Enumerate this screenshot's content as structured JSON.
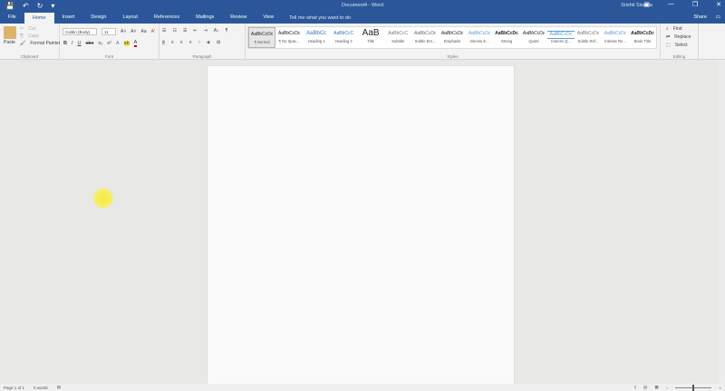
{
  "titlebar": {
    "title": "Document4 - Word",
    "user": "Srishti Sisodia",
    "qat": {
      "save": "💾",
      "undo": "↶",
      "redo": "↻",
      "customize": "▾"
    },
    "min": "—",
    "max": "❐",
    "close": "✕",
    "display": "▣"
  },
  "tabs": [
    "File",
    "Home",
    "Insert",
    "Design",
    "Layout",
    "References",
    "Mailings",
    "Review",
    "View"
  ],
  "tell_me": "Tell me what you want to do",
  "share": "Share",
  "clipboard": {
    "paste": "Paste",
    "cut": "Cut",
    "copy": "Copy",
    "format_painter": "Format Painter",
    "label": "Clipboard"
  },
  "font": {
    "name": "Calibri (Body)",
    "size": "11",
    "grow": "A˄",
    "shrink": "A˅",
    "case": "Aa",
    "clear": "A̸",
    "bold": "B",
    "italic": "I",
    "underline": "U",
    "strike": "abc",
    "sub": "x₂",
    "sup": "x²",
    "effects": "A",
    "highlight": "ab",
    "color": "A",
    "label": "Font"
  },
  "paragraph": {
    "label": "Paragraph",
    "bullets": "☰",
    "numbering": "☷",
    "multilevel": "☰",
    "dec_indent": "⇤",
    "inc_indent": "⇥",
    "sort": "A↓",
    "pilcrow": "¶",
    "left": "≡",
    "center": "≡",
    "right": "≡",
    "justify": "≡",
    "spacing": "↕",
    "shading": "◈",
    "borders": "⊞"
  },
  "styles": {
    "label": "Styles",
    "items": [
      {
        "preview": "AaBbCcDc",
        "name": "¶ Normal"
      },
      {
        "preview": "AaBbCcDc",
        "name": "¶ No Spac..."
      },
      {
        "preview": "AaBbCc",
        "name": "Heading 1"
      },
      {
        "preview": "AaBbCcC",
        "name": "Heading 2"
      },
      {
        "preview": "AaB",
        "name": "Title"
      },
      {
        "preview": "AaBbCcC",
        "name": "Subtitle"
      },
      {
        "preview": "AaBbCcDc",
        "name": "Subtle Em..."
      },
      {
        "preview": "AaBbCcDc",
        "name": "Emphasis"
      },
      {
        "preview": "AaBbCcDc",
        "name": "Intense E..."
      },
      {
        "preview": "AaBbCcDc",
        "name": "Strong"
      },
      {
        "preview": "AaBbCcDc",
        "name": "Quote"
      },
      {
        "preview": "AaBbCcDc",
        "name": "Intense Q..."
      },
      {
        "preview": "AaBbCcDc",
        "name": "Subtle Ref..."
      },
      {
        "preview": "AaBbCcDc",
        "name": "Intense Re..."
      },
      {
        "preview": "AaBbCcDc",
        "name": "Book Title"
      }
    ]
  },
  "editing": {
    "find": "Find",
    "replace": "Replace",
    "select": "Select",
    "label": "Editing"
  },
  "status": {
    "page": "Page 1 of 1",
    "words": "0 words"
  },
  "colors": {
    "brand": "#2b579a",
    "highlight": "#f6ea3a"
  }
}
